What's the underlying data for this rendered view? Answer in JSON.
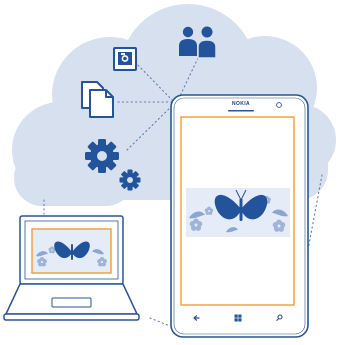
{
  "phone": {
    "brand": "NOKIA"
  },
  "colors": {
    "cloud": "#d6e0ee",
    "outline": "#2a5590",
    "accent": "#f39c2e",
    "screen": "#ffffff",
    "icon": "#23539a",
    "connector": "#5b7fb0"
  },
  "icons": [
    "photo-icon",
    "documents-icon",
    "settings-gears-icon",
    "people-icon"
  ],
  "navigation_icons": [
    "back-arrow-icon",
    "windows-start-icon",
    "search-icon"
  ]
}
